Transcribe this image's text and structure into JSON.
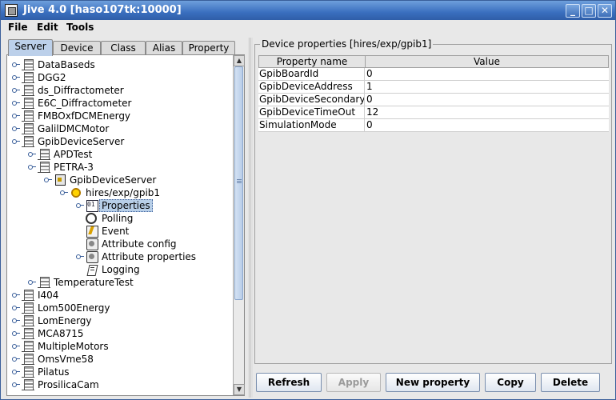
{
  "window": {
    "title": "Jive 4.0  [haso107tk:10000]",
    "controls": {
      "minimize": "_",
      "maximize": "□",
      "close": "✕"
    }
  },
  "menu": {
    "items": [
      "File",
      "Edit",
      "Tools"
    ]
  },
  "left_panel": {
    "tabs": [
      "Server",
      "Device",
      "Class",
      "Alias",
      "Property"
    ],
    "active_tab": "Server",
    "tree": [
      {
        "label": "DataBaseds",
        "icon": "server-icon"
      },
      {
        "label": "DGG2",
        "icon": "server-icon"
      },
      {
        "label": "ds_Diffractometer",
        "icon": "server-icon"
      },
      {
        "label": "E6C_Diffractometer",
        "icon": "server-icon"
      },
      {
        "label": "FMBOxfDCMEnergy",
        "icon": "server-icon"
      },
      {
        "label": "GalilDMCMotor",
        "icon": "server-icon"
      },
      {
        "label": "GpibDeviceServer",
        "icon": "server-icon"
      },
      {
        "label": "APDTest",
        "icon": "server-icon"
      },
      {
        "label": "PETRA-3",
        "icon": "server-icon"
      },
      {
        "label": "GpibDeviceServer",
        "icon": "class-icon"
      },
      {
        "label": "hires/exp/gpib1",
        "icon": "device-icon"
      },
      {
        "label": "Properties",
        "icon": "properties-icon"
      },
      {
        "label": "Polling",
        "icon": "polling-icon"
      },
      {
        "label": "Event",
        "icon": "event-icon"
      },
      {
        "label": "Attribute config",
        "icon": "attribute-config-icon"
      },
      {
        "label": "Attribute properties",
        "icon": "attribute-properties-icon"
      },
      {
        "label": "Logging",
        "icon": "logging-icon"
      },
      {
        "label": "TemperatureTest",
        "icon": "server-icon"
      },
      {
        "label": "I404",
        "icon": "server-icon"
      },
      {
        "label": "Lom500Energy",
        "icon": "server-icon"
      },
      {
        "label": "LomEnergy",
        "icon": "server-icon"
      },
      {
        "label": "MCA8715",
        "icon": "server-icon"
      },
      {
        "label": "MultipleMotors",
        "icon": "server-icon"
      },
      {
        "label": "OmsVme58",
        "icon": "server-icon"
      },
      {
        "label": "Pilatus",
        "icon": "server-icon"
      },
      {
        "label": "ProsilicaCam",
        "icon": "server-icon"
      }
    ],
    "selected": "Properties",
    "scroll_arrows": {
      "up": "▲",
      "down": "▼"
    }
  },
  "right_panel": {
    "group_title": "Device properties [hires/exp/gpib1]",
    "table": {
      "headers": [
        "Property name",
        "Value"
      ],
      "rows": [
        [
          "GpibBoardId",
          "0"
        ],
        [
          "GpibDeviceAddress",
          "1"
        ],
        [
          "GpibDeviceSecondaryA",
          "0"
        ],
        [
          "GpibDeviceTimeOut",
          "12"
        ],
        [
          "SimulationMode",
          "0"
        ]
      ]
    },
    "buttons": [
      {
        "label": "Refresh",
        "enabled": true
      },
      {
        "label": "Apply",
        "enabled": false
      },
      {
        "label": "New property",
        "enabled": true
      },
      {
        "label": "Copy",
        "enabled": true
      },
      {
        "label": "Delete",
        "enabled": true
      }
    ]
  },
  "colors": {
    "title_bar": "#3a6fbf",
    "selection": "#b8cfe8",
    "tree_lines": "#3a5f9a"
  }
}
